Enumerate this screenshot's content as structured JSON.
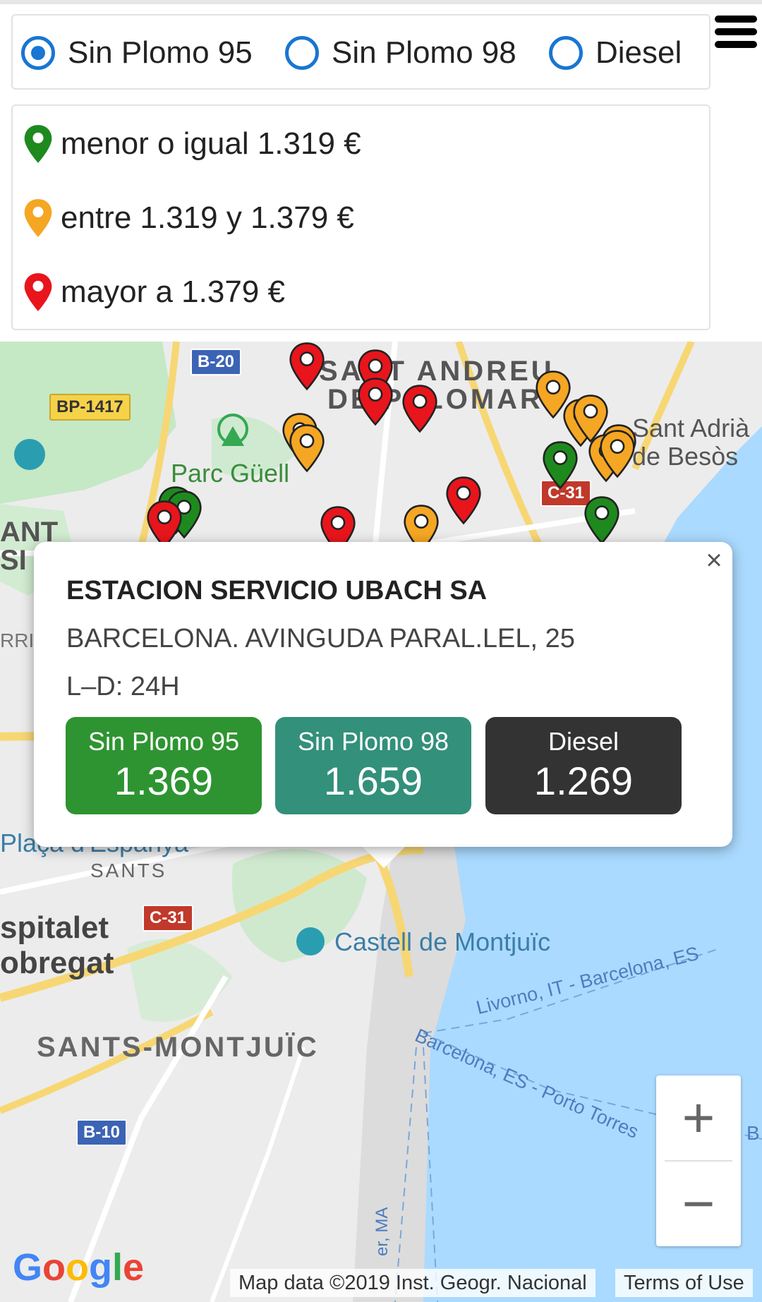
{
  "fuel_selector": {
    "options": [
      {
        "label": "Sin Plomo 95",
        "checked": true
      },
      {
        "label": "Sin Plomo 98",
        "checked": false
      },
      {
        "label": "Diesel",
        "checked": false
      }
    ]
  },
  "legend": {
    "items": [
      {
        "color": "#1e8a1e",
        "label": "menor o igual 1.319 €"
      },
      {
        "color": "#f5a623",
        "label": "entre 1.319 y 1.379 €"
      },
      {
        "color": "#e8151c",
        "label": "mayor a 1.379 €"
      }
    ]
  },
  "map": {
    "labels": {
      "sant_andreu_1": "SANT ANDREU",
      "sant_andreu_2": "DE PALOMAR",
      "sant_adria_1": "Sant Adrià",
      "sant_adria_2": "de Besòs",
      "parc_guell": "Parc Güell",
      "plaça": "Plaça d'Espanya",
      "sants": "SANTS",
      "hospitalet_1": "spitalet",
      "hospitalet_2": "obregat",
      "castell": "Castell de Montjuïc",
      "sants_montjuic": "SANTS-MONTJUÏC",
      "ferry_1": "Livorno, IT - Barcelona, ES",
      "ferry_2": "Barcelona, ES - Porto Torres",
      "ant": "ANT",
      "si": "SI",
      "rr": "RRI",
      "moll": "er, MA",
      "edge_b": "B"
    },
    "road_tags": {
      "b20": "B-20",
      "bp1417": "BP-1417",
      "c31_top": "C-31",
      "c31_bottom": "C-31",
      "b10": "B-10"
    },
    "zoom_in": "+",
    "zoom_out": "−",
    "google": "Google",
    "attribution": "Map data ©2019 Inst. Geogr. Nacional",
    "terms": "Terms of Use"
  },
  "popup": {
    "title": "ESTACION SERVICIO UBACH SA",
    "address": "BARCELONA. AVINGUDA PARAL.LEL, 25",
    "hours": "L–D: 24H",
    "close": "×",
    "prices": [
      {
        "name": "Sin Plomo 95",
        "value": "1.369",
        "color": "#2e9431"
      },
      {
        "name": "Sin Plomo 98",
        "value": "1.659",
        "color": "#33907a"
      },
      {
        "name": "Diesel",
        "value": "1.269",
        "color": "#333333"
      }
    ]
  },
  "colors": {
    "green_pin": "#1e8a1e",
    "orange_pin": "#f5a623",
    "red_pin": "#e8151c",
    "radio_blue": "#1976d2",
    "water": "#aadaff",
    "park": "#c5e8c5",
    "road_yellow": "#f7d774"
  }
}
